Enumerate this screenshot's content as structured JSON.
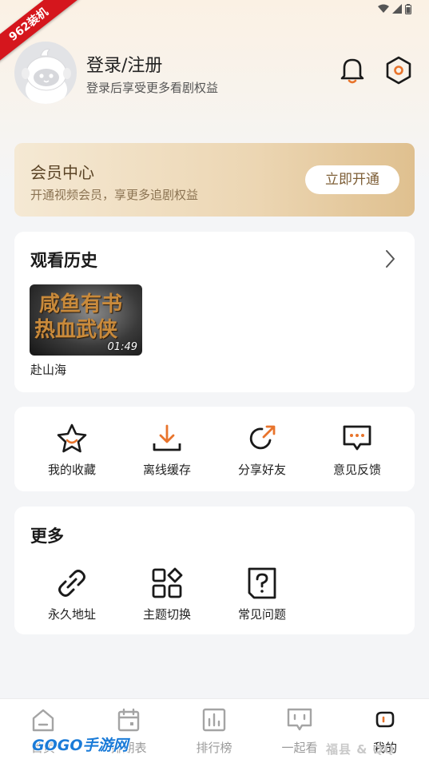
{
  "ribbon": "962装机",
  "profile": {
    "title": "登录/注册",
    "subtitle": "登录后享受更多看剧权益"
  },
  "vip": {
    "title": "会员中心",
    "subtitle": "开通视频会员，享更多追剧权益",
    "button": "立即开通"
  },
  "history": {
    "title": "观看历史",
    "items": [
      {
        "thumb_line1": "咸鱼有书",
        "thumb_line2": "热血武侠",
        "duration": "01:49",
        "name": "赴山海"
      }
    ]
  },
  "quick_actions": [
    {
      "label": "我的收藏",
      "icon": "star-icon"
    },
    {
      "label": "离线缓存",
      "icon": "download-icon"
    },
    {
      "label": "分享好友",
      "icon": "share-icon"
    },
    {
      "label": "意见反馈",
      "icon": "feedback-icon"
    }
  ],
  "more": {
    "title": "更多",
    "items": [
      {
        "label": "永久地址",
        "icon": "link-icon"
      },
      {
        "label": "主题切换",
        "icon": "grid-icon"
      },
      {
        "label": "常见问题",
        "icon": "question-icon"
      }
    ]
  },
  "nav": [
    {
      "label": "首页",
      "icon": "home-icon"
    },
    {
      "label": "排期表",
      "icon": "calendar-icon"
    },
    {
      "label": "排行榜",
      "icon": "chart-icon"
    },
    {
      "label": "一起看",
      "icon": "chat-icon"
    },
    {
      "label": "我的",
      "icon": "profile-icon",
      "active": true
    }
  ],
  "watermarks": {
    "left": "GOGO手游网",
    "right": "福县 & QQ"
  },
  "colors": {
    "accent": "#e8742c",
    "vip_gold": "#dfc08f",
    "ribbon": "#d5161d"
  }
}
